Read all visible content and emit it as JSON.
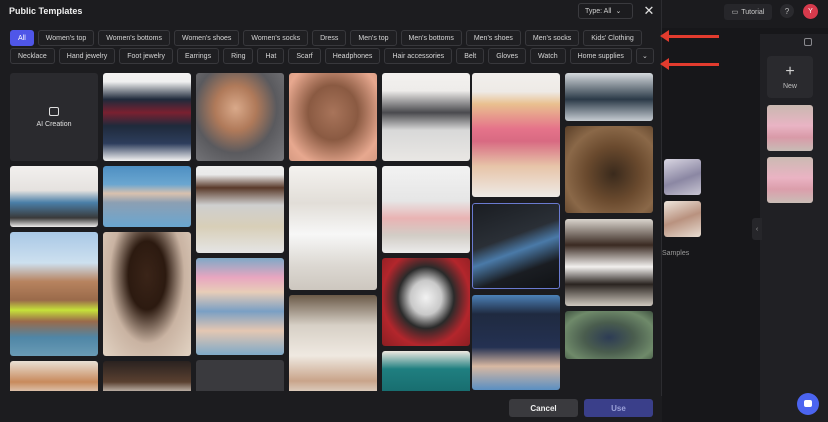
{
  "modal": {
    "title": "Public Templates",
    "type_filter": "Type: All",
    "close_icon": "close-icon",
    "categories_row1": [
      "All",
      "Women's top",
      "Women's bottoms",
      "Women's shoes",
      "Women's socks",
      "Dress",
      "Men's top",
      "Men's bottoms",
      "Men's shoes",
      "Men's socks",
      "Kids' Clothing"
    ],
    "categories_row2": [
      "Necklace",
      "Hand jewelry",
      "Foot jewelry",
      "Earrings",
      "Ring",
      "Hat",
      "Scarf",
      "Headphones",
      "Hair accessories",
      "Belt",
      "Gloves",
      "Watch",
      "Home supplies"
    ],
    "active_category": "All",
    "ai_creation_label": "AI Creation",
    "cancel_label": "Cancel",
    "use_label": "Use"
  },
  "app": {
    "tutorial_label": "Tutorial",
    "help_label": "?",
    "avatar_initial": "Y",
    "new_label": "New",
    "samples_label": "Samples"
  },
  "colors": {
    "accent": "#4f56e8",
    "annotation_arrow": "#e23b2e",
    "avatar": "#d63a4c"
  }
}
